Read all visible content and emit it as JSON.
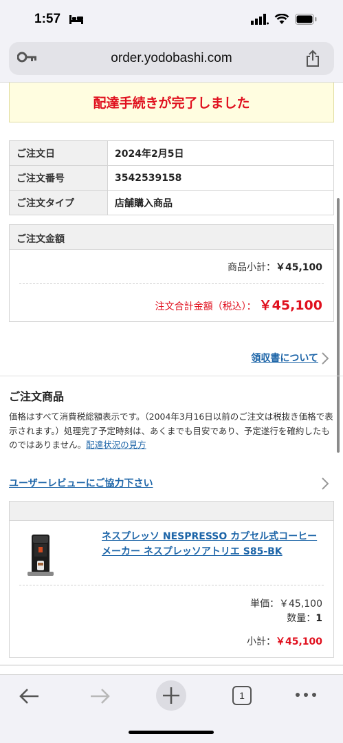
{
  "status_bar": {
    "time": "1:57"
  },
  "browser": {
    "url": "order.yodobashi.com",
    "tab_count": "1"
  },
  "banner": {
    "message": "配達手続きが完了しました"
  },
  "order_info": {
    "rows": [
      {
        "label": "ご注文日",
        "value": "2024年2月5日"
      },
      {
        "label": "ご注文番号",
        "value": "3542539158"
      },
      {
        "label": "ご注文タイプ",
        "value": "店舗購入商品"
      }
    ]
  },
  "amount": {
    "heading": "ご注文金額",
    "subtotal_label": "商品小計：",
    "subtotal_value": "￥45,100",
    "total_label": "注文合計金額（税込）：",
    "total_value": "￥45,100"
  },
  "receipt_link": "領収書について",
  "products_section": {
    "title": "ご注文商品",
    "note_text": "価格はすべて消費税総額表示です。（2004年3月16日以前のご注文は税抜き価格で表示されます。）処理完了予定時刻は、あくまでも目安であり、予定遂行を確約したものではありません。",
    "note_link": "配達状況の見方",
    "review_link": "ユーザーレビューにご協力下さい"
  },
  "product": {
    "name": "ネスプレッソ NESPRESSO カプセル式コーヒーメーカー ネスプレッソアトリエ S85-BK",
    "unit_label": "単価：",
    "unit_price": "￥45,100",
    "qty_label": "数量：",
    "qty": "1",
    "line_label": "小計：",
    "line_total": "￥45,100"
  },
  "colors": {
    "accent_red": "#e0101e",
    "link_blue": "#1d65a8",
    "banner_bg": "#fffde0"
  }
}
